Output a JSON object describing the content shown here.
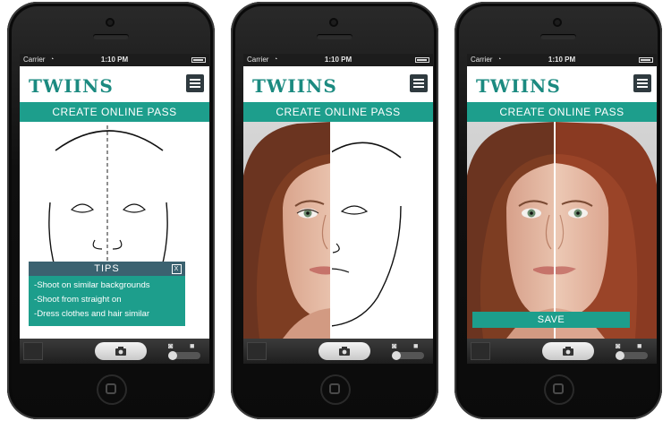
{
  "phones": [
    {
      "status": {
        "carrier": "Carrier",
        "wifi": "wifi-icon",
        "time": "1:10 PM"
      },
      "logo": "TWIINS",
      "banner": "CREATE ONLINE PASS",
      "tips": {
        "title": "TIPS",
        "close_label": "X",
        "items": [
          "-Shoot on similar backgrounds",
          "-Shoot from straight on",
          "-Dress clothes and hair similar"
        ]
      }
    },
    {
      "status": {
        "carrier": "Carrier",
        "wifi": "wifi-icon",
        "time": "1:10 PM"
      },
      "logo": "TWIINS",
      "banner": "CREATE ONLINE PASS"
    },
    {
      "status": {
        "carrier": "Carrier",
        "wifi": "wifi-icon",
        "time": "1:10 PM"
      },
      "logo": "TWIINS",
      "banner": "CREATE ONLINE PASS",
      "save_label": "SAVE"
    }
  ],
  "colors": {
    "accent": "#1d9e8c",
    "logo": "#1b8a80",
    "tips_header": "#3b6270",
    "menu_button": "#2f3a3f"
  },
  "icons": {
    "menu": "hamburger-menu-icon",
    "shutter": "camera-icon",
    "mode_photo": "photo-camera-icon",
    "mode_video": "video-camera-icon"
  }
}
